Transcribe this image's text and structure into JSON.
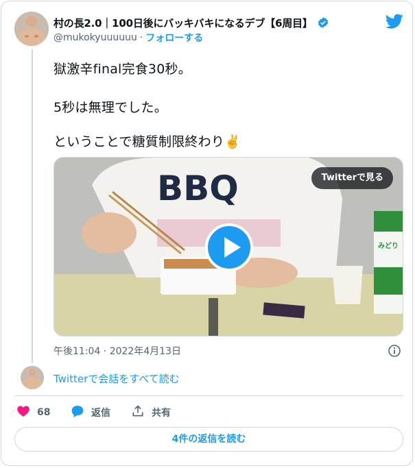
{
  "author": {
    "display_name": "村の長2.0｜100日後にバッキバキになるデブ【6周目】",
    "handle": "@mukokyuuuuuu",
    "separator": "·",
    "follow_label": "フォローする"
  },
  "tweet": {
    "lines": [
      "獄激辛final完食30秒。",
      "5秒は無理でした。",
      "ということで糖質制限終わり✌️"
    ],
    "timestamp": "午後11:04 · 2022年4月13日"
  },
  "media": {
    "watch_label": "Twitterで見る",
    "shirt_text": "BBQ",
    "milk_text": "みどり"
  },
  "conversation": {
    "read_label": "Twitterで会話をすべて読む"
  },
  "actions": {
    "like_count": "68",
    "reply_label": "返信",
    "share_label": "共有"
  },
  "replies_button": "4件の返信を読む",
  "colors": {
    "accent": "#1d9bf0",
    "like": "#f91880",
    "muted": "#536471",
    "border": "#cfd9de"
  }
}
